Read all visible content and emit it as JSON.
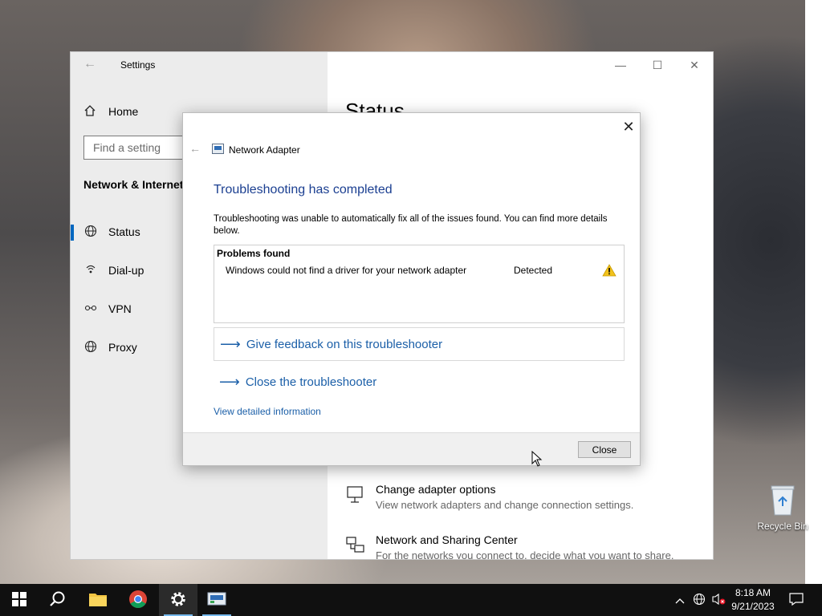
{
  "settings": {
    "window_title": "Settings",
    "home_label": "Home",
    "search_placeholder": "Find a setting",
    "section_heading": "Network & Internet",
    "nav": [
      {
        "label": "Status",
        "icon": "globe-icon",
        "selected": true
      },
      {
        "label": "Dial-up",
        "icon": "dial-up-icon",
        "selected": false
      },
      {
        "label": "VPN",
        "icon": "vpn-icon",
        "selected": false
      },
      {
        "label": "Proxy",
        "icon": "globe-icon",
        "selected": false
      }
    ],
    "main_title": "Status",
    "links": [
      {
        "title": "Change adapter options",
        "subtitle": "View network adapters and change connection settings.",
        "icon": "adapter-icon"
      },
      {
        "title": "Network and Sharing Center",
        "subtitle": "For the networks you connect to, decide what you want to share.",
        "icon": "sharing-center-icon"
      }
    ]
  },
  "dialog": {
    "title": "Network Adapter",
    "heading": "Troubleshooting has completed",
    "description": "Troubleshooting was unable to automatically fix all of the issues found. You can find more details below.",
    "problems_header": "Problems found",
    "problems": [
      {
        "text": "Windows could not find a driver for your network adapter",
        "status": "Detected",
        "icon": "warning-icon"
      }
    ],
    "feedback_link": "Give feedback on this troubleshooter",
    "close_troubleshooter_link": "Close the troubleshooter",
    "view_detailed": "View detailed information",
    "close_button": "Close"
  },
  "desktop": {
    "recycle_bin_label": "Recycle Bin"
  },
  "taskbar": {
    "time": "8:18 AM",
    "date": "9/21/2023",
    "accent_color": "#76b9ed"
  }
}
